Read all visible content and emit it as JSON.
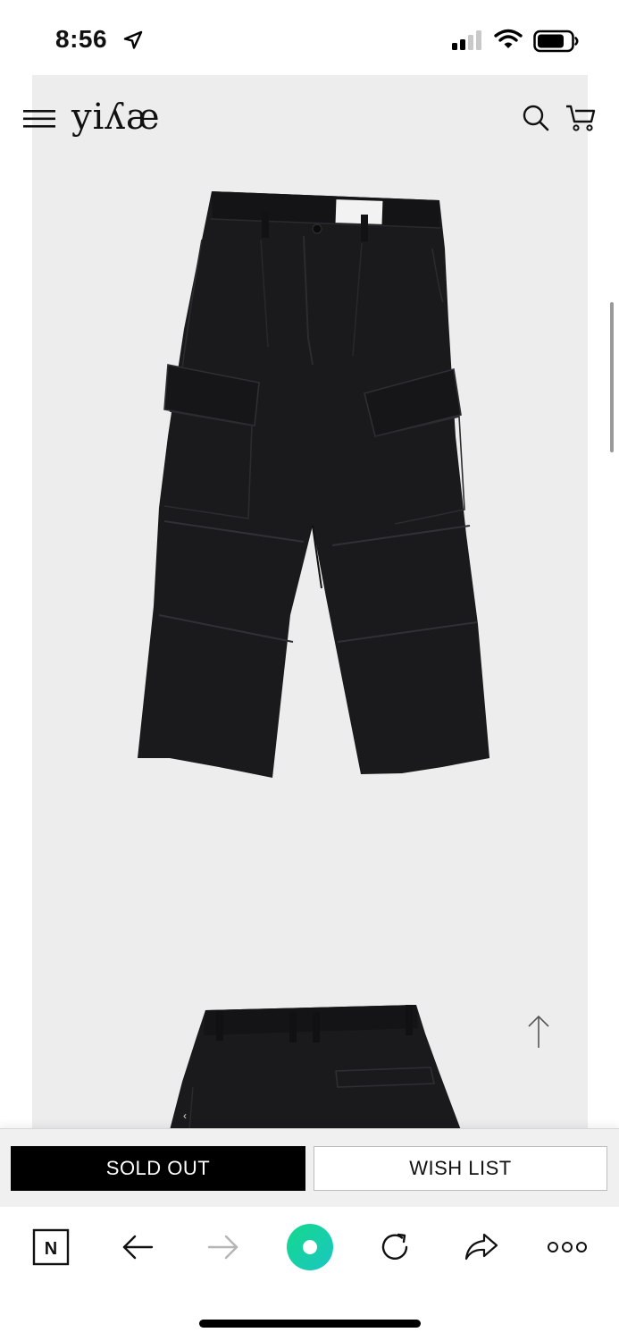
{
  "status_bar": {
    "time": "8:56",
    "icons": [
      "location-arrow-icon",
      "cellular-signal-icon",
      "wifi-icon",
      "battery-icon"
    ]
  },
  "site": {
    "logo": "yiʎæ",
    "header_icons": [
      "hamburger-menu-icon",
      "search-icon",
      "cart-icon"
    ]
  },
  "product": {
    "images": [
      "cargo-pants-front",
      "cargo-pants-back"
    ],
    "colors": {
      "page_bg": "#ededee",
      "garment": "#1a1a1d"
    }
  },
  "actions": {
    "sold_out_label": "SOLD OUT",
    "wish_list_label": "WISH LIST"
  },
  "browser_toolbar": {
    "naver_label": "N",
    "buttons": [
      "naver-icon",
      "back-arrow-icon",
      "forward-arrow-icon",
      "home-circle-icon",
      "reload-icon",
      "share-icon",
      "more-dots-icon"
    ],
    "accent": "#1fd3a4"
  }
}
